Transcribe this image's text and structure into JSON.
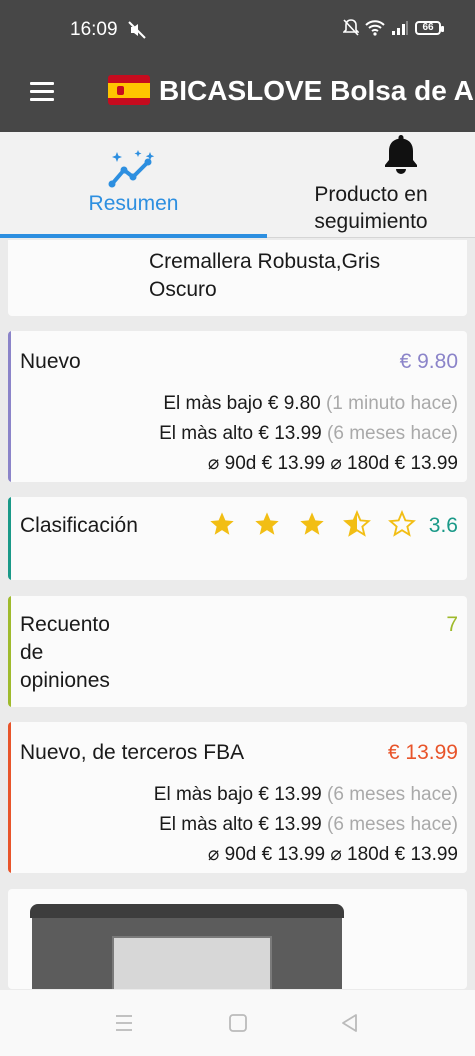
{
  "status_bar": {
    "time": "16:09",
    "battery": "66"
  },
  "app_bar": {
    "title": "BICASLOVE Bolsa de Al"
  },
  "tabs": [
    {
      "label": "Resumen"
    },
    {
      "label": "Producto en seguimiento"
    }
  ],
  "product": {
    "title_fragment": "Cremallera Robusta,Gris Oscuro"
  },
  "nuevo": {
    "label": "Nuevo",
    "price": "€ 9.80",
    "lowest_label": "El màs bajo",
    "lowest_price": "€ 9.80",
    "lowest_when": "(1 minuto hace)",
    "highest_label": "El màs alto",
    "highest_price": "€ 13.99",
    "highest_when": "(6 meses hace)",
    "avg90_label": "⌀ 90d",
    "avg90": "€ 13.99",
    "avg180_label": "⌀ 180d",
    "avg180": "€ 13.99",
    "accent": "#8b84c9"
  },
  "rating": {
    "label": "Clasificación",
    "value": "3.6",
    "stars": 3.5,
    "accent": "#1a9988"
  },
  "reviews": {
    "label": "Recuento de opiniones",
    "value": "7",
    "accent": "#9fba2c"
  },
  "fba": {
    "label": "Nuevo, de terceros FBA",
    "price": "€ 13.99",
    "lowest_label": "El màs bajo",
    "lowest_price": "€ 13.99",
    "lowest_when": "(6 meses hace)",
    "highest_label": "El màs alto",
    "highest_price": "€ 13.99",
    "highest_when": "(6 meses hace)",
    "avg90_label": "⌀ 90d",
    "avg90": "€ 13.99",
    "avg180_label": "⌀ 180d",
    "avg180": "€ 13.99",
    "accent": "#e8542a"
  },
  "icons": {
    "status": [
      "mute-icon",
      "do-not-disturb-icon",
      "wifi-icon",
      "signal-icon",
      "battery-icon"
    ],
    "nav": [
      "recents-icon",
      "home-icon",
      "back-icon"
    ]
  }
}
